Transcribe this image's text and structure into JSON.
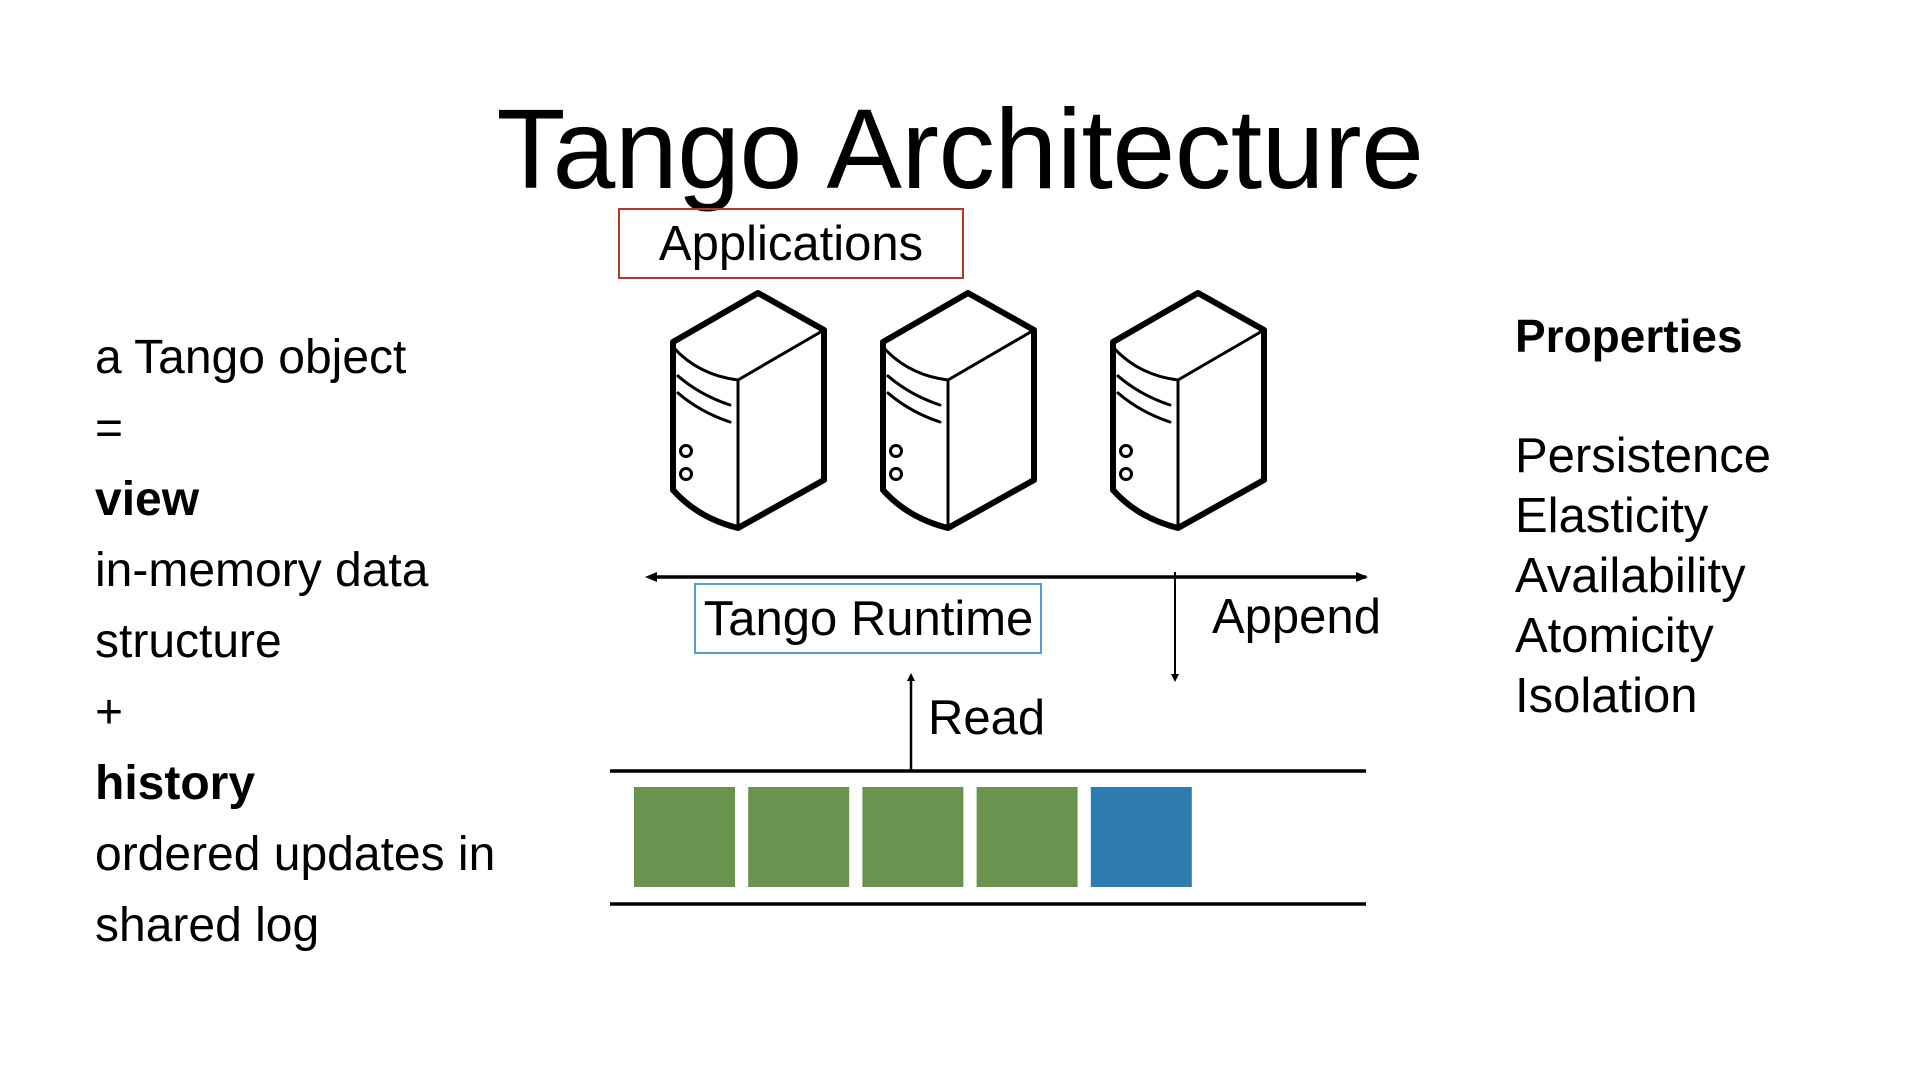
{
  "slide": {
    "title": "Tango Architecture"
  },
  "left_panel": {
    "lines": [
      {
        "text": "a Tango object",
        "bold": false
      },
      {
        "text": "=",
        "bold": false
      },
      {
        "text": "view",
        "bold": true
      },
      {
        "text": "in-memory data",
        "bold": false
      },
      {
        "text": "structure",
        "bold": false
      },
      {
        "text": "+",
        "bold": false
      },
      {
        "text": "history",
        "bold": true
      },
      {
        "text": "ordered updates in",
        "bold": false
      },
      {
        "text": "shared log",
        "bold": false
      }
    ]
  },
  "properties": {
    "heading": "Properties",
    "items": [
      "Persistence",
      "Elasticity",
      "Availability",
      "Atomicity",
      "Isolation"
    ]
  },
  "diagram": {
    "applications_label": "Applications",
    "runtime_label": "Tango Runtime",
    "append_label": "Append",
    "read_label": "Read",
    "servers": [
      {
        "icon": "server-icon"
      },
      {
        "icon": "server-icon"
      },
      {
        "icon": "server-icon"
      }
    ],
    "log_entries": [
      {
        "state": "committed",
        "color": "#6a9350"
      },
      {
        "state": "committed",
        "color": "#6a9350"
      },
      {
        "state": "committed",
        "color": "#6a9350"
      },
      {
        "state": "committed",
        "color": "#6a9350"
      },
      {
        "state": "new",
        "color": "#2e7bb0"
      }
    ],
    "colors": {
      "applications_border": "#b0392a",
      "runtime_border": "#5b9bd5"
    }
  }
}
